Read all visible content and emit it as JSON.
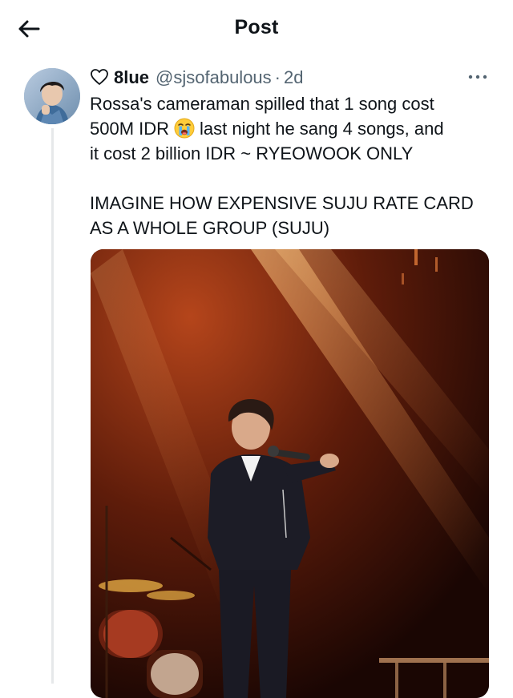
{
  "header": {
    "title": "Post",
    "back_icon": "arrow-left-icon"
  },
  "tweet": {
    "display_name": "8lue",
    "handle": "@sjsofabulous",
    "separator": "·",
    "time": "2d",
    "name_prefix_icon": "heart-outline-icon",
    "more_icon": "more-horizontal-icon",
    "text_line1": "Rossa's cameraman spilled that 1 song cost",
    "text_line2a": "500M IDR",
    "text_line2_emoji": "loudly-crying-face-icon",
    "text_line2b": "last night he sang 4 songs, and",
    "text_line3": "it cost 2 billion IDR ~ RYEOWOOK ONLY",
    "text_line4": "IMAGINE HOW EXPENSIVE SUJU RATE CARD",
    "text_line5": "AS A WHOLE GROUP (SUJU)",
    "media": {
      "kind": "photo",
      "subject": "concert-singer-on-stage"
    }
  },
  "colors": {
    "text": "#0f1419",
    "secondary": "#536471",
    "thread_line": "#e6e8ea",
    "stage_dark": "#1a0603",
    "stage_glow": "#b5451b"
  }
}
